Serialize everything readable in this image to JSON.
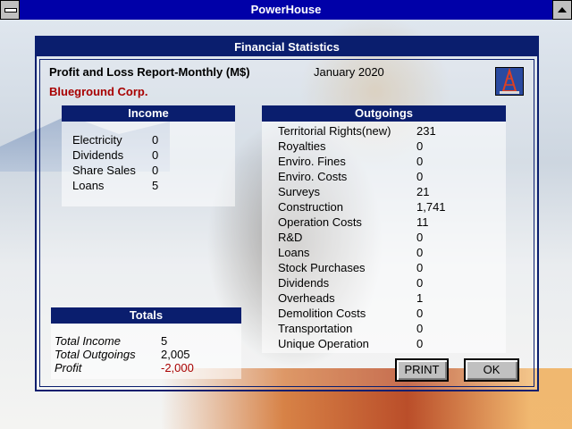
{
  "window": {
    "title": "PowerHouse"
  },
  "dialog": {
    "title": "Financial Statistics"
  },
  "report": {
    "title": "Profit and Loss Report-Monthly (M$)",
    "date": "January 2020",
    "company": "Blueground Corp."
  },
  "income": {
    "header": "Income",
    "items": [
      {
        "label": "Electricity",
        "value": "0"
      },
      {
        "label": "Dividends",
        "value": "0"
      },
      {
        "label": "Share Sales",
        "value": "0"
      },
      {
        "label": "Loans",
        "value": "5"
      }
    ]
  },
  "outgoings": {
    "header": "Outgoings",
    "items": [
      {
        "label": "Territorial Rights(new)",
        "value": "231"
      },
      {
        "label": "Royalties",
        "value": "0"
      },
      {
        "label": "Enviro. Fines",
        "value": "0"
      },
      {
        "label": "Enviro. Costs",
        "value": "0"
      },
      {
        "label": "Surveys",
        "value": "21"
      },
      {
        "label": "Construction",
        "value": "1,741"
      },
      {
        "label": "Operation Costs",
        "value": "11"
      },
      {
        "label": "R&D",
        "value": "0"
      },
      {
        "label": "Loans",
        "value": "0"
      },
      {
        "label": "Stock Purchases",
        "value": "0"
      },
      {
        "label": "Dividends",
        "value": "0"
      },
      {
        "label": "Overheads",
        "value": "1"
      },
      {
        "label": "Demolition Costs",
        "value": "0"
      },
      {
        "label": "Transportation",
        "value": "0"
      },
      {
        "label": "Unique Operation",
        "value": "0"
      }
    ]
  },
  "totals": {
    "header": "Totals",
    "income_label": "Total Income",
    "income_value": "5",
    "outgoings_label": "Total Outgoings",
    "outgoings_value": "2,005",
    "profit_label": "Profit",
    "profit_value": "-2,000"
  },
  "buttons": {
    "print": "PRINT",
    "ok": "OK"
  },
  "icons": {
    "derrick": "oil-derrick-icon",
    "system_menu": "system-menu-icon",
    "scroll_up": "up-arrow-icon"
  },
  "colors": {
    "title_bar": "#0000a8",
    "panel_header": "#0a1e6e",
    "company": "#a80000",
    "negative": "#a80000"
  }
}
